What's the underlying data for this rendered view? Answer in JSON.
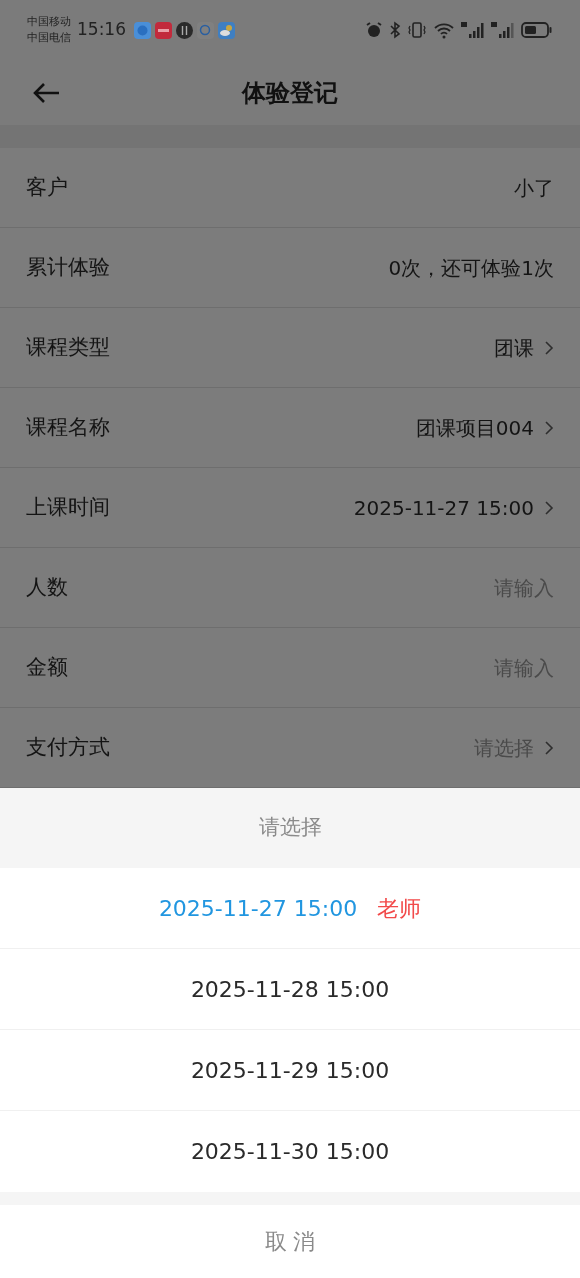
{
  "status_bar": {
    "carriers": [
      "中国移动",
      "中国电信"
    ],
    "time": "15:16"
  },
  "header": {
    "title": "体验登记"
  },
  "form": [
    {
      "label": "客户",
      "value": "小了",
      "kind": "text"
    },
    {
      "label": "累计体验",
      "value": "0次，还可体验1次",
      "kind": "text"
    },
    {
      "label": "课程类型",
      "value": "团课",
      "kind": "select"
    },
    {
      "label": "课程名称",
      "value": "团课项目004",
      "kind": "select"
    },
    {
      "label": "上课时间",
      "value": "2025-11-27 15:00",
      "kind": "select"
    },
    {
      "label": "人数",
      "placeholder": "请输入",
      "kind": "input"
    },
    {
      "label": "金额",
      "placeholder": "请输入",
      "kind": "input"
    },
    {
      "label": "支付方式",
      "placeholder": "请选择",
      "kind": "select"
    }
  ],
  "sheet": {
    "title": "请选择",
    "options": [
      {
        "label": "2025-11-27 15:00",
        "tag": "老师",
        "selected": true
      },
      {
        "label": "2025-11-28 15:00",
        "selected": false
      },
      {
        "label": "2025-11-29 15:00",
        "selected": false
      },
      {
        "label": "2025-11-30 15:00",
        "selected": false
      }
    ],
    "cancel": "取 消"
  }
}
